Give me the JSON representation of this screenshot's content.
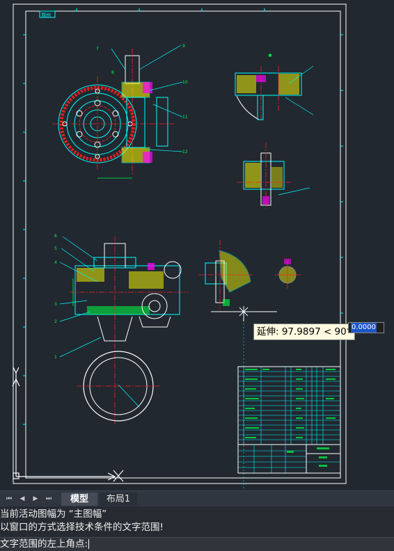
{
  "drawing": {
    "title_tag": "郑州",
    "tooltip_text": "延伸: 97.9897 < 90°",
    "dyn_input_value": "0.0000",
    "part_numbers_top": [
      "7",
      "8",
      "9",
      "10",
      "11",
      "12"
    ],
    "part_numbers_bottom": [
      "6",
      "5",
      "4",
      "3",
      "2",
      "1"
    ]
  },
  "colors": {
    "canvas": "#212830",
    "frame": "#ffffff",
    "geometry": "#00ffff",
    "center_lines": "#ff2020",
    "hatch": "#ffff00",
    "dimensions": "#00ff44",
    "accent": "#ff00ff"
  },
  "layout_tabs": {
    "nav_first": "⏮",
    "nav_prev": "◀",
    "nav_next": "▶",
    "nav_last": "⏭",
    "model": "模型",
    "layout1": "布局1"
  },
  "command": {
    "history": [
      "当前活动图幅为 “主图幅”",
      "以窗口的方式选择技术条件的文字范围!"
    ],
    "prompt": "文字范围的左上角点:"
  }
}
